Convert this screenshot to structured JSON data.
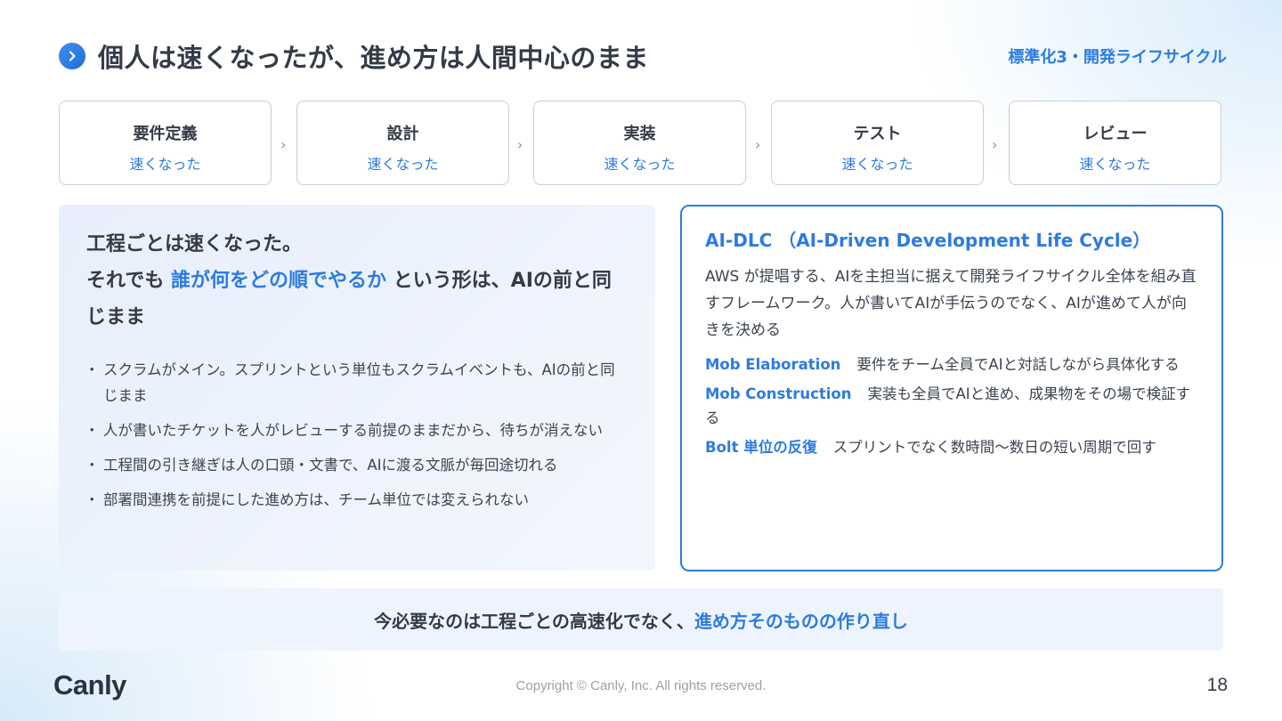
{
  "header": {
    "title": "個人は速くなったが、進め方は人間中心のまま",
    "section_tag": "標準化3・開発ライフサイクル"
  },
  "process": {
    "steps": [
      {
        "name": "要件定義",
        "status": "速くなった"
      },
      {
        "name": "設計",
        "status": "速くなった"
      },
      {
        "name": "実装",
        "status": "速くなった"
      },
      {
        "name": "テスト",
        "status": "速くなった"
      },
      {
        "name": "レビュー",
        "status": "速くなった"
      }
    ],
    "separator": "›"
  },
  "left_panel": {
    "line1": "工程ごとは速くなった。",
    "line2_prefix": "それでも ",
    "line2_highlight": "誰が何をどの順でやるか",
    "line2_suffix": " という形は、AIの前と同じまま",
    "bullets": [
      "スクラムがメイン。スプリントという単位もスクラムイベントも、AIの前と同じまま",
      "人が書いたチケットを人がレビューする前提のままだから、待ちが消えない",
      "工程間の引き継ぎは人の口頭・文書で、AIに渡る文脈が毎回途切れる",
      "部署間連携を前提にした進め方は、チーム単位では変えられない"
    ]
  },
  "right_panel": {
    "title": "AI-DLC （AI-Driven Development Life Cycle）",
    "description": "AWS が提唱する、AIを主担当に据えて開発ライフサイクル全体を組み直すフレームワーク。人が書いてAIが手伝うのでなく、AIが進めて人が向きを決める",
    "items": [
      {
        "term": "Mob Elaboration",
        "text": "要件をチーム全員でAIと対話しながら具体化する"
      },
      {
        "term": "Mob Construction",
        "text": "実装も全員でAIと進め、成果物をその場で検証する"
      },
      {
        "term": "Bolt 単位の反復",
        "text": "スプリントでなく数時間〜数日の短い周期で回す"
      }
    ]
  },
  "banner": {
    "prefix": "今必要なのは工程ごとの高速化でなく、",
    "highlight": "進め方そのものの作り直し"
  },
  "footer": {
    "logo": "Canly",
    "copyright": "Copyright © Canly, Inc. All rights reserved.",
    "page_number": "18"
  },
  "colors": {
    "accent": "#2d7be0",
    "text": "#333b47",
    "panel_bg": "#eef4fd",
    "border": "#c9ced6"
  },
  "icons": {
    "title_icon": "chevron-right-circle-icon"
  }
}
